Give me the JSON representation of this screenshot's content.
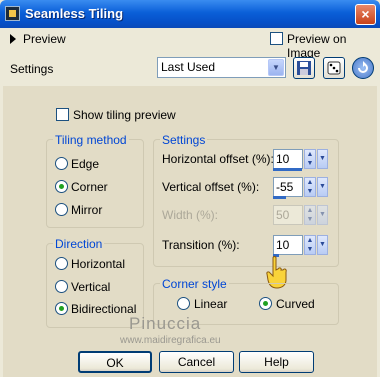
{
  "window": {
    "title": "Seamless Tiling",
    "close": "×"
  },
  "preview": {
    "label": "Preview",
    "preview_on_image": "Preview on Image"
  },
  "settings_row": {
    "label": "Settings",
    "preset_value": "Last Used"
  },
  "show_tiling_preview": "Show tiling preview",
  "tiling_method": {
    "title": "Tiling method",
    "options": [
      "Edge",
      "Corner",
      "Mirror"
    ],
    "selected": "Corner"
  },
  "direction": {
    "title": "Direction",
    "options": [
      "Horizontal",
      "Vertical",
      "Bidirectional"
    ],
    "selected": "Bidirectional"
  },
  "settings": {
    "title": "Settings",
    "horizontal_offset": {
      "label": "Horizontal offset (%):",
      "value": "10"
    },
    "vertical_offset": {
      "label": "Vertical offset (%):",
      "value": "-55"
    },
    "width": {
      "label": "Width (%):",
      "value": "50"
    },
    "transition": {
      "label": "Transition (%):",
      "value": "10"
    }
  },
  "corner_style": {
    "title": "Corner style",
    "options": [
      "Linear",
      "Curved"
    ],
    "selected": "Curved"
  },
  "watermark": {
    "name": "Pinuccia",
    "url": "www.maidiregrafica.eu"
  },
  "buttons": {
    "ok": "OK",
    "cancel": "Cancel",
    "help": "Help"
  },
  "colors": {
    "title_bar": "#0a5fd8",
    "panel": "#e2dcc6",
    "group_label": "#0046d5",
    "radio_dot": "#21a121"
  }
}
